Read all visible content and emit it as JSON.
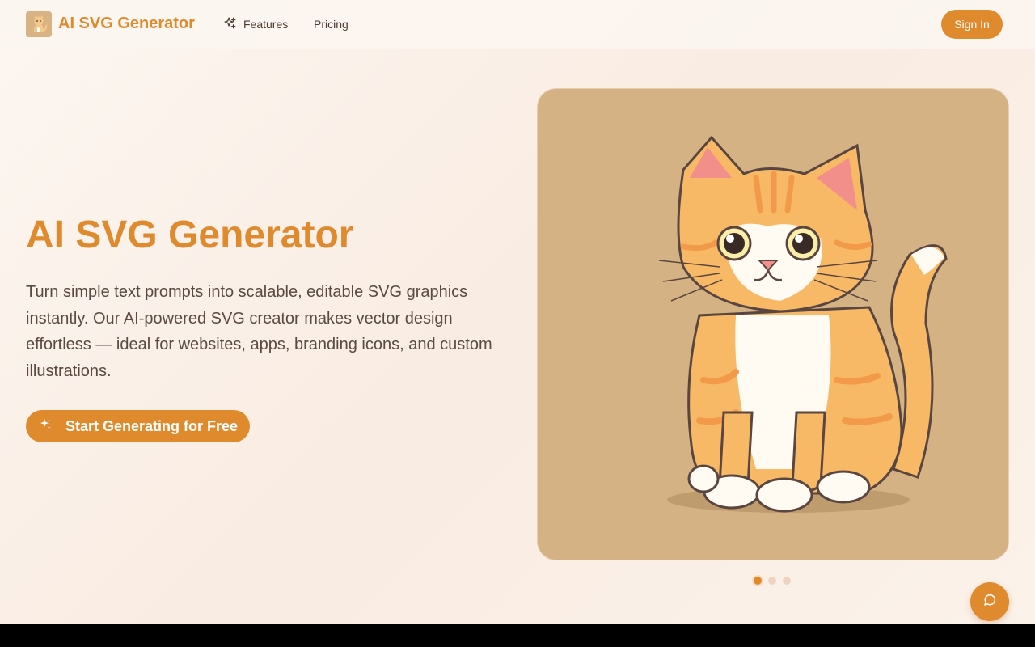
{
  "header": {
    "brand": "AI SVG Generator",
    "nav": {
      "features": "Features",
      "pricing": "Pricing"
    },
    "sign_in": "Sign In"
  },
  "hero": {
    "title": "AI SVG Generator",
    "description": "Turn simple text prompts into scalable, editable SVG graphics instantly. Our AI-powered SVG creator makes vector design effortless — ideal for websites, apps, branding icons, and custom illustrations.",
    "cta": "Start Generating for Free"
  },
  "carousel": {
    "slide_count": 3,
    "active_slide": 1,
    "image_subject": "orange-tabby-kitten"
  },
  "colors": {
    "accent": "#e08a2e",
    "card_background": "#d4b283",
    "text": "#5a4a40"
  },
  "icons": {
    "features": "sparkles-icon",
    "cta": "sparkles-icon",
    "chat": "chat-bubble-icon"
  }
}
